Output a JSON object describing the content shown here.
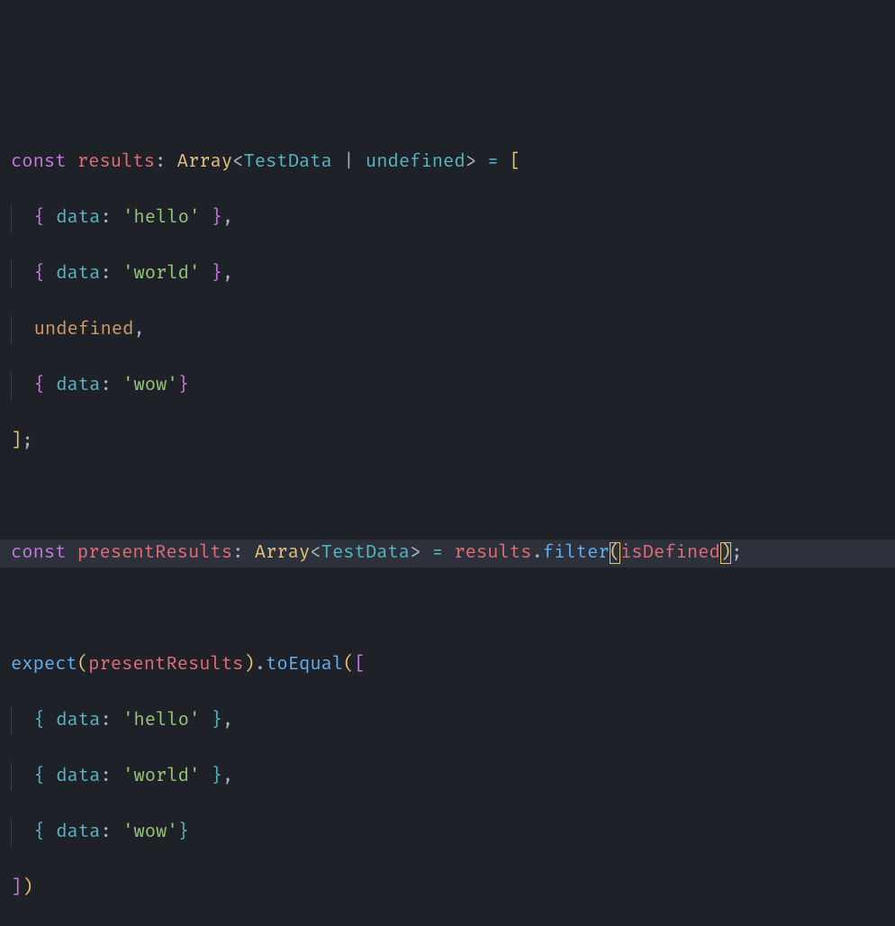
{
  "code": {
    "l1": {
      "const": "const",
      "results": "results",
      "colon": ":",
      "Array": "Array",
      "lt": "<",
      "TestData": "TestData",
      "pipe": "|",
      "undefined": "undefined",
      "gt": ">",
      "eq": "=",
      "lbrack": "["
    },
    "l2": {
      "lbrace": "{",
      "data": "data",
      "colon": ":",
      "str": "'hello'",
      "rbrace": "}",
      "comma": ","
    },
    "l3": {
      "lbrace": "{",
      "data": "data",
      "colon": ":",
      "str": "'world'",
      "rbrace": "}",
      "comma": ","
    },
    "l4": {
      "undefined": "undefined",
      "comma": ","
    },
    "l5": {
      "lbrace": "{",
      "data": "data",
      "colon": ":",
      "str": "'wow'",
      "rbrace": "}"
    },
    "l6": {
      "rbrack": "]",
      "semi": ";"
    },
    "l8": {
      "const": "const",
      "presentResults": "presentResults",
      "colon": ":",
      "Array": "Array",
      "lt": "<",
      "TestData": "TestData",
      "gt": ">",
      "eq": "=",
      "results": "results",
      "dot": ".",
      "filter": "filter",
      "lparen": "(",
      "isDefined": "isDefined",
      "rparen": ")",
      "semi": ";"
    },
    "l10": {
      "expect": "expect",
      "lparen": "(",
      "presentResults": "presentResults",
      "rparen": ")",
      "dot": ".",
      "toEqual": "toEqual",
      "lparen2": "(",
      "lbrack": "["
    },
    "l11": {
      "lbrace": "{",
      "data": "data",
      "colon": ":",
      "str": "'hello'",
      "rbrace": "}",
      "comma": ","
    },
    "l12": {
      "lbrace": "{",
      "data": "data",
      "colon": ":",
      "str": "'world'",
      "rbrace": "}",
      "comma": ","
    },
    "l13": {
      "lbrace": "{",
      "data": "data",
      "colon": ":",
      "str": "'wow'",
      "rbrace": "}"
    },
    "l14": {
      "rbrack": "]",
      "rparen": ")"
    }
  }
}
